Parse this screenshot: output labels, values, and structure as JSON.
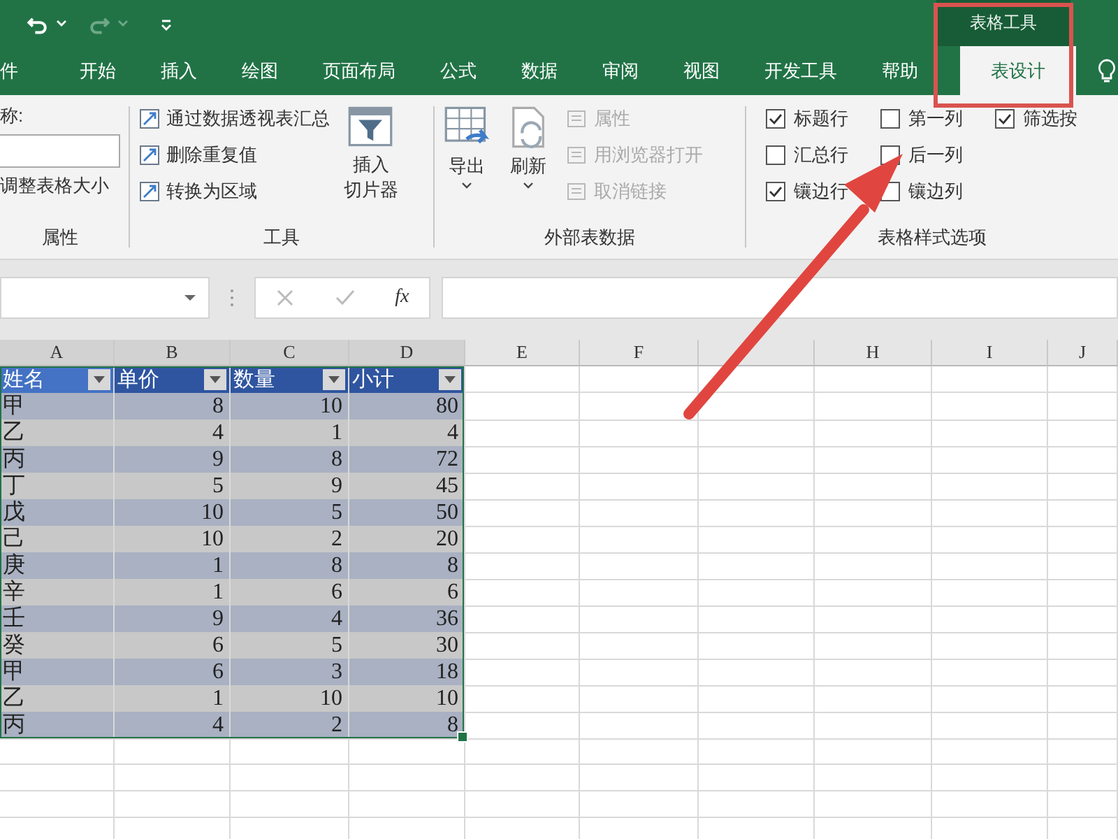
{
  "contextual_group": {
    "title": "表格工具"
  },
  "tabs": [
    {
      "label": "件",
      "selected": false
    },
    {
      "label": "开始",
      "selected": false
    },
    {
      "label": "插入",
      "selected": false
    },
    {
      "label": "绘图",
      "selected": false
    },
    {
      "label": "页面布局",
      "selected": false
    },
    {
      "label": "公式",
      "selected": false
    },
    {
      "label": "数据",
      "selected": false
    },
    {
      "label": "审阅",
      "selected": false
    },
    {
      "label": "视图",
      "selected": false
    },
    {
      "label": "开发工具",
      "selected": false
    },
    {
      "label": "帮助",
      "selected": false
    },
    {
      "label": "表设计",
      "selected": true
    }
  ],
  "properties_group": {
    "name_label": "称:",
    "resize_button": "调整表格大小",
    "label": "属性"
  },
  "tools_group": {
    "items": [
      {
        "label": "通过数据透视表汇总"
      },
      {
        "label": "删除重复值"
      },
      {
        "label": "转换为区域"
      }
    ],
    "slicer_button": [
      "插入",
      "切片器"
    ],
    "label": "工具"
  },
  "external_group": {
    "export_button": "导出",
    "refresh_button": "刷新",
    "items": [
      {
        "label": "属性",
        "disabled": true
      },
      {
        "label": "用浏览器打开",
        "disabled": true
      },
      {
        "label": "取消链接",
        "disabled": true
      }
    ],
    "label": "外部表数据"
  },
  "style_options": {
    "columns": [
      [
        {
          "label": "标题行",
          "checked": true
        },
        {
          "label": "汇总行",
          "checked": false
        },
        {
          "label": "镶边行",
          "checked": true
        }
      ],
      [
        {
          "label": "第一列",
          "checked": false
        },
        {
          "label": "后一列",
          "checked": false
        },
        {
          "label": "镶边列",
          "checked": false
        }
      ],
      [
        {
          "label": "筛选按",
          "checked": true
        }
      ]
    ],
    "label": "表格样式选项"
  },
  "formula_bar": {
    "fx": "fx"
  },
  "columns": [
    {
      "label": "A",
      "selected": true
    },
    {
      "label": "B",
      "selected": true
    },
    {
      "label": "C",
      "selected": true
    },
    {
      "label": "D",
      "selected": true
    },
    {
      "label": "E",
      "selected": false
    },
    {
      "label": "F",
      "selected": false
    },
    {
      "selected": false
    },
    {
      "label": "H",
      "selected": false
    },
    {
      "label": "I",
      "selected": false
    },
    {
      "label": "J",
      "selected": false
    }
  ],
  "table": {
    "headers": [
      "姓名",
      "单价",
      "数量",
      "小计"
    ],
    "rows": [
      [
        "甲",
        "8",
        "10",
        "80"
      ],
      [
        "乙",
        "4",
        "1",
        "4"
      ],
      [
        "丙",
        "9",
        "8",
        "72"
      ],
      [
        "丁",
        "5",
        "9",
        "45"
      ],
      [
        "戊",
        "10",
        "5",
        "50"
      ],
      [
        "己",
        "10",
        "2",
        "20"
      ],
      [
        "庚",
        "1",
        "8",
        "8"
      ],
      [
        "辛",
        "1",
        "6",
        "6"
      ],
      [
        "壬",
        "9",
        "4",
        "36"
      ],
      [
        "癸",
        "6",
        "5",
        "30"
      ],
      [
        "甲",
        "6",
        "3",
        "18"
      ],
      [
        "乙",
        "1",
        "10",
        "10"
      ],
      [
        "丙",
        "4",
        "2",
        "8"
      ]
    ]
  }
}
